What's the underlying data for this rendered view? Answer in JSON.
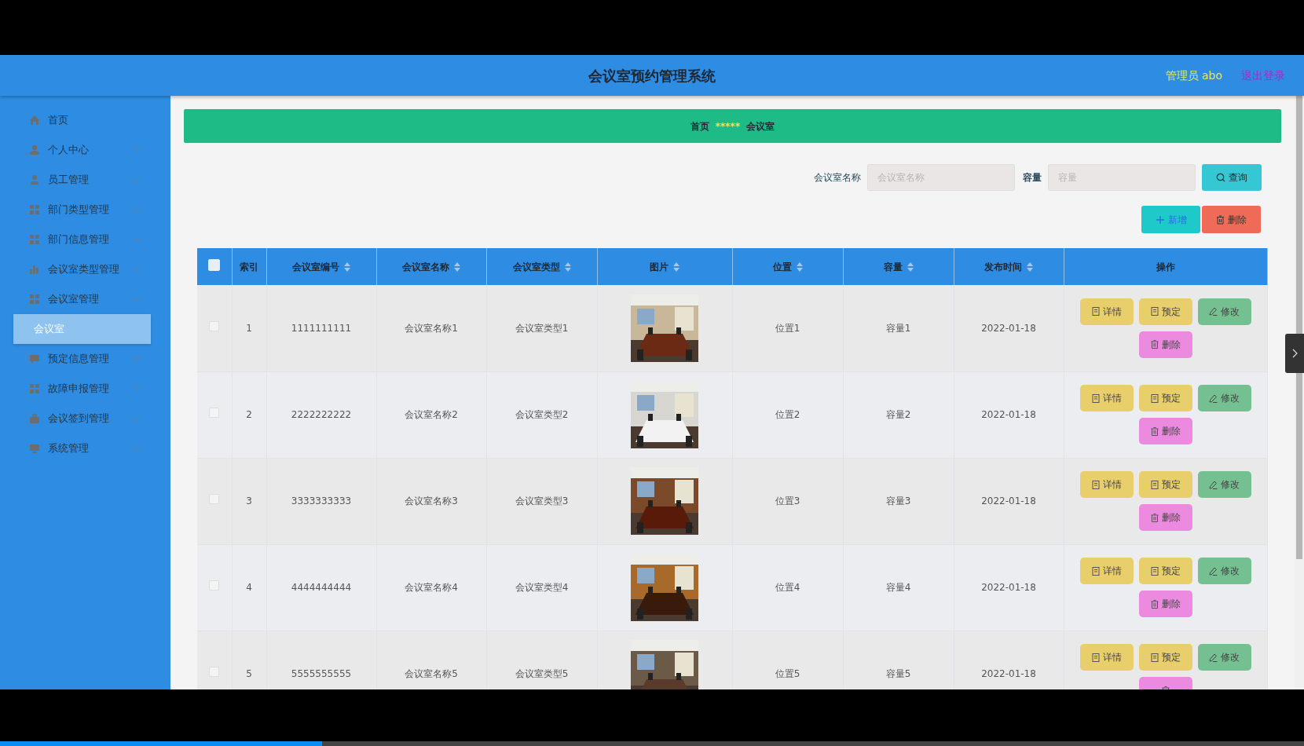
{
  "header": {
    "title": "会议室预约管理系统",
    "user": "管理员 abo",
    "logout": "退出登录"
  },
  "sidebar": {
    "items": [
      {
        "label": "首页",
        "expandable": false
      },
      {
        "label": "个人中心",
        "expandable": true
      },
      {
        "label": "员工管理",
        "expandable": true
      },
      {
        "label": "部门类型管理",
        "expandable": true
      },
      {
        "label": "部门信息管理",
        "expandable": true
      },
      {
        "label": "会议室类型管理",
        "expandable": true
      },
      {
        "label": "会议室管理",
        "expandable": true,
        "children": [
          {
            "label": "会议室",
            "selected": true
          }
        ]
      },
      {
        "label": "预定信息管理",
        "expandable": true
      },
      {
        "label": "故障申报管理",
        "expandable": true
      },
      {
        "label": "会议签到管理",
        "expandable": true
      },
      {
        "label": "系统管理",
        "expandable": true
      }
    ]
  },
  "breadcrumb": {
    "items": [
      "首页",
      "会议室"
    ],
    "separator": "*****"
  },
  "search": {
    "fields": [
      {
        "label": "会议室名称",
        "placeholder": "会议室名称"
      },
      {
        "label": "容量",
        "placeholder": "容量"
      }
    ],
    "button": "查询"
  },
  "toolbar": [
    {
      "kind": "add",
      "label": "新增"
    },
    {
      "kind": "delete",
      "label": "删除"
    }
  ],
  "table": {
    "select_all": {
      "checked": false
    },
    "columns": [
      {
        "label": "索引",
        "sortable": false
      },
      {
        "label": "会议室编号",
        "sortable": true
      },
      {
        "label": "会议室名称",
        "sortable": true
      },
      {
        "label": "会议室类型",
        "sortable": true
      },
      {
        "label": "图片",
        "sortable": true
      },
      {
        "label": "位置",
        "sortable": true
      },
      {
        "label": "容量",
        "sortable": true
      },
      {
        "label": "发布时间",
        "sortable": true
      },
      {
        "label": "操作",
        "sortable": false
      }
    ],
    "rows": [
      {
        "checked": false,
        "cells": [
          "1",
          "1111111111",
          "会议室名称1",
          "会议室类型1",
          {
            "kind": "picture"
          },
          "位置1",
          "容量1",
          "2022-01-18"
        ],
        "actions": [
          {
            "kind": "detail",
            "label": "详情"
          },
          {
            "kind": "book",
            "label": "预定"
          },
          {
            "kind": "edit",
            "label": "修改"
          },
          {
            "kind": "delete",
            "label": "删除"
          }
        ]
      },
      {
        "checked": false,
        "cells": [
          "2",
          "2222222222",
          "会议室名称2",
          "会议室类型2",
          {
            "kind": "picture"
          },
          "位置2",
          "容量2",
          "2022-01-18"
        ],
        "actions": [
          {
            "kind": "detail",
            "label": "详情"
          },
          {
            "kind": "book",
            "label": "预定"
          },
          {
            "kind": "edit",
            "label": "修改"
          },
          {
            "kind": "delete",
            "label": "删除"
          }
        ]
      },
      {
        "checked": false,
        "cells": [
          "3",
          "3333333333",
          "会议室名称3",
          "会议室类型3",
          {
            "kind": "picture"
          },
          "位置3",
          "容量3",
          "2022-01-18"
        ],
        "actions": [
          {
            "kind": "detail",
            "label": "详情"
          },
          {
            "kind": "book",
            "label": "预定"
          },
          {
            "kind": "edit",
            "label": "修改"
          },
          {
            "kind": "delete",
            "label": "删除"
          }
        ]
      },
      {
        "checked": false,
        "cells": [
          "4",
          "4444444444",
          "会议室名称4",
          "会议室类型4",
          {
            "kind": "picture"
          },
          "位置4",
          "容量4",
          "2022-01-18"
        ],
        "actions": [
          {
            "kind": "detail",
            "label": "详情"
          },
          {
            "kind": "book",
            "label": "预定"
          },
          {
            "kind": "edit",
            "label": "修改"
          },
          {
            "kind": "delete",
            "label": "删除"
          }
        ]
      },
      {
        "checked": false,
        "cells": [
          "5",
          "5555555555",
          "会议室名称5",
          "会议室类型5",
          {
            "kind": "picture"
          },
          "位置5",
          "容量5",
          "2022-01-18"
        ],
        "actions": [
          {
            "kind": "detail",
            "label": "详情"
          },
          {
            "kind": "book",
            "label": "预定"
          },
          {
            "kind": "edit",
            "label": "修改"
          },
          {
            "kind": "delete"
          }
        ]
      }
    ]
  },
  "player": {
    "level": 0.247
  }
}
